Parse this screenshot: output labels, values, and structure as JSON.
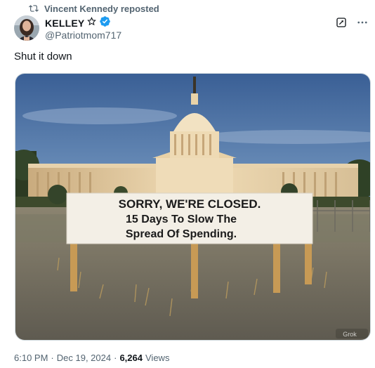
{
  "repost": {
    "text": "Vincent Kennedy reposted",
    "icon": "repost-icon"
  },
  "author": {
    "name": "KELLEY",
    "handle": "@Patriotmom717",
    "badges": [
      "star-icon",
      "verified-badge-icon"
    ]
  },
  "actions": {
    "grok": "grok-icon",
    "more": "more-icon"
  },
  "tweet": {
    "text": "Shut it down"
  },
  "media": {
    "sign_line1": "SORRY, WE'RE CLOSED.",
    "sign_line2": "15 Days To Slow The",
    "sign_line3": "Spread Of Spending.",
    "watermark": "Grok"
  },
  "meta": {
    "time": "6:10 PM",
    "sep1": "·",
    "date": "Dec 19, 2024",
    "sep2": "·",
    "views_count": "6,264",
    "views_label": "Views"
  },
  "colors": {
    "accent": "#1d9bf0",
    "muted": "#536471",
    "text": "#0f1419"
  }
}
